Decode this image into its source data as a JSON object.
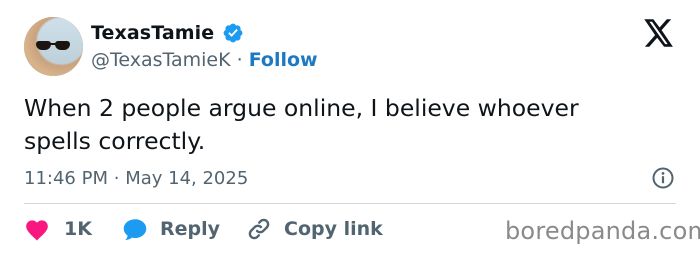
{
  "author": {
    "display_name": "TexasTamie",
    "handle": "@TexasTamieK",
    "separator": "·",
    "follow_label": "Follow"
  },
  "tweet": {
    "text_line1": "When 2 people argue online,  I believe whoever",
    "text_line2": "spells correctly.",
    "time": "11:46 PM",
    "meta_separator": "·",
    "date": "May 14, 2025"
  },
  "actions": {
    "like_count": "1K",
    "reply_label": "Reply",
    "copy_label": "Copy link"
  },
  "watermark": "boredpanda.com",
  "icons": {
    "verified": "verified-badge-icon",
    "platform": "x-logo-icon",
    "info": "info-icon",
    "like": "heart-icon",
    "reply": "speech-bubble-icon",
    "copy": "link-icon"
  },
  "colors": {
    "like": "#f91880",
    "reply": "#1d9bf0",
    "follow": "#1d79c2",
    "verified": "#1d9bf0",
    "muted": "#536471"
  }
}
